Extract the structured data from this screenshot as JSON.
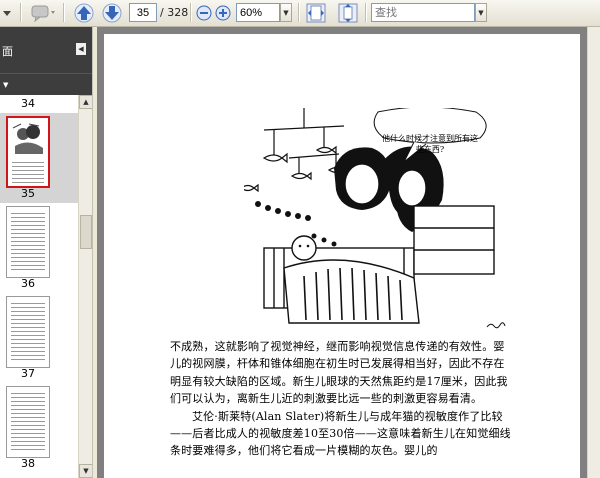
{
  "toolbar": {
    "current_page": "35",
    "total_pages": "/ 328",
    "zoom": "60%",
    "search_placeholder": "查找"
  },
  "sidebar": {
    "title": "面",
    "thumbnails": [
      {
        "label": "34",
        "selected": false
      },
      {
        "label": "35",
        "selected": true
      },
      {
        "label": "36",
        "selected": false
      },
      {
        "label": "37",
        "selected": false
      },
      {
        "label": "38",
        "selected": false
      }
    ]
  },
  "page": {
    "speech_bubble": "他什么时候才注意到所有这些东西?",
    "paragraph1": "不成熟，这就影响了视觉神经，继而影响视觉信息传递的有效性。婴儿的视网膜，杆体和锥体细胞在初生时已发展得相当好，因此不存在明显有较大缺陷的区域。新生儿眼球的天然焦距约是17厘米，因此我们可以认为，离新生儿近的刺激要比远一些的刺激更容易看清。",
    "paragraph2": "艾伦·斯莱特(Alan Slater)将新生儿与成年猫的视敏度作了比较——后者比成人的视敏度差10至30倍——这意味着新生儿在知觉细线条时要难得多，他们将它看成一片模糊的灰色。婴儿的"
  },
  "colors": {
    "selection_border": "#d0151a",
    "sidebar_header": "#3d3d3d",
    "doc_background": "#808080",
    "toolbar_icon_blue": "#3566b8"
  }
}
